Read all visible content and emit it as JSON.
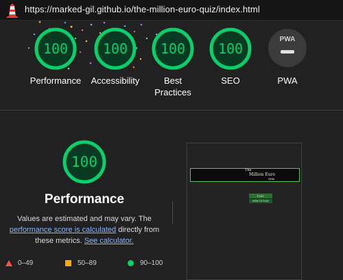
{
  "header": {
    "url": "https://marked-gil.github.io/the-million-euro-quiz/index.html",
    "logo_icon": "lighthouse-icon"
  },
  "categories": [
    {
      "label": "Performance",
      "score": "100",
      "score_value": 100
    },
    {
      "label": "Accessibility",
      "score": "100",
      "score_value": 100
    },
    {
      "label": "Best Practices",
      "score": "100",
      "score_value": 100
    },
    {
      "label": "SEO",
      "score": "100",
      "score_value": 100
    },
    {
      "label": "PWA",
      "badge_text": "PWA"
    }
  ],
  "detail": {
    "score": "100",
    "score_value": 100,
    "title": "Performance",
    "desc_prefix": "Values are estimated and may vary. The",
    "desc_link": "performance score is calculated",
    "desc_middle": "directly from these metrics.",
    "desc_link2": "See calculator."
  },
  "legend": [
    {
      "range": "0–49",
      "color": "#ff4e42",
      "shape": "triangle"
    },
    {
      "range": "50–89",
      "color": "#ffa400",
      "shape": "square"
    },
    {
      "range": "90–100",
      "color": "#0cce6b",
      "shape": "circle"
    }
  ],
  "screenshot": {
    "line1": "The",
    "line2": "Million Euro",
    "line3": "Quiz",
    "play_label": "PLAY",
    "how_label": "HOW TO PLAY"
  },
  "colors": {
    "pass": "#0cce6b",
    "pass_bg": "#0b3a22",
    "average": "#ffa400",
    "fail": "#ff4e42",
    "link": "#8ab4f8",
    "background": "#212121"
  }
}
